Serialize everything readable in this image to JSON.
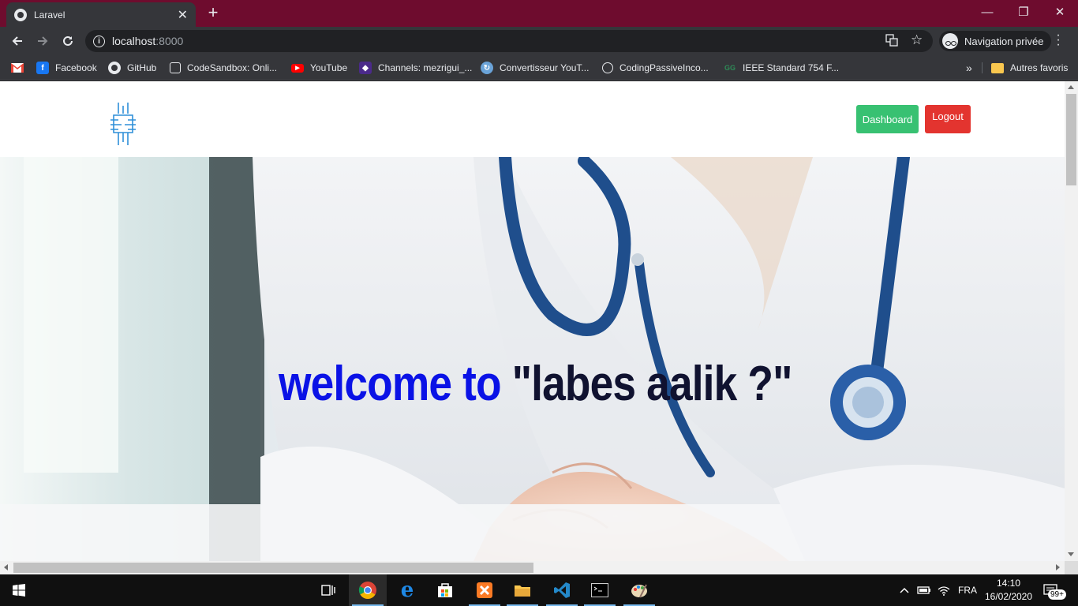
{
  "browser": {
    "tab": {
      "title": "Laravel",
      "close_glyph": "✕"
    },
    "new_tab_glyph": "+",
    "window_controls": {
      "minimize": "—",
      "restore": "❐",
      "close": "✕"
    },
    "url": {
      "host": "localhost",
      "port": ":8000"
    },
    "profile_label": "Navigation privée",
    "bookmarks": [
      {
        "label": "",
        "icon": "gmail-icon",
        "color": "#ea4335"
      },
      {
        "label": "Facebook",
        "icon": "facebook-icon",
        "color": "#1877f2"
      },
      {
        "label": "GitHub",
        "icon": "github-icon",
        "color": "#e8eaed"
      },
      {
        "label": "CodeSandbox: Onli...",
        "icon": "codesandbox-icon",
        "color": "#e8eaed"
      },
      {
        "label": "YouTube",
        "icon": "youtube-icon",
        "color": "#ff0000"
      },
      {
        "label": "Channels: mezrigui_...",
        "icon": "channels-icon",
        "color": "#4b2a8a"
      },
      {
        "label": "Convertisseur YouT...",
        "icon": "converter-icon",
        "color": "#6aa3d8"
      },
      {
        "label": "CodingPassiveInco...",
        "icon": "globe-icon",
        "color": "#e8eaed"
      },
      {
        "label": "IEEE Standard 754 F...",
        "icon": "ieee-icon",
        "color": "#2e8b57"
      }
    ],
    "bookmarks_overflow": "»",
    "other_bookmarks": "Autres favoris"
  },
  "page": {
    "nav": {
      "dashboard_label": "Dashboard",
      "logout_label": "Logout"
    },
    "hero": {
      "title_part1": "welcome to",
      "title_part2": " \"labes aalik ?\""
    }
  },
  "taskbar": {
    "language": "FRA",
    "time": "14:10",
    "date": "16/02/2020",
    "notification_count": "99+"
  },
  "colors": {
    "titlebar": "#6e0c2e",
    "dashboard_button": "#38c172",
    "logout_button": "#e3342f",
    "hero_blue": "#0a12e6",
    "hero_dark": "#101230"
  }
}
